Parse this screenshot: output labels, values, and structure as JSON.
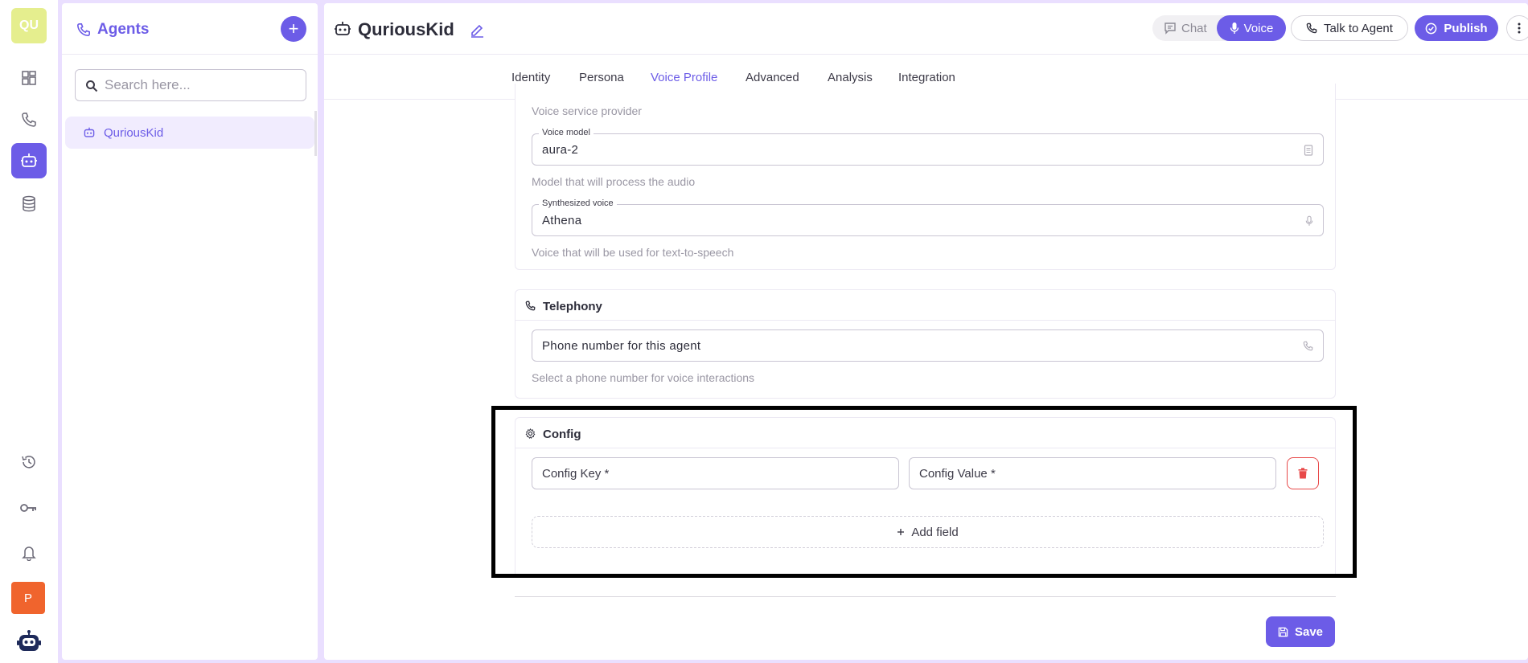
{
  "workspace": {
    "initials": "QU",
    "user_initial": "P"
  },
  "agents_panel": {
    "title": "Agents",
    "add_label": "+",
    "search_placeholder": "Search here...",
    "items": [
      {
        "label": "QuriousKid"
      }
    ]
  },
  "header": {
    "agent_name": "QuriousKid",
    "chat_label": "Chat",
    "voice_label": "Voice",
    "talk_label": "Talk to Agent",
    "publish_label": "Publish"
  },
  "tabs": [
    {
      "label": "Identity"
    },
    {
      "label": "Persona"
    },
    {
      "label": "Voice Profile",
      "active": true
    },
    {
      "label": "Advanced"
    },
    {
      "label": "Analysis"
    },
    {
      "label": "Integration"
    }
  ],
  "voice": {
    "provider_helper": "Voice service provider",
    "model_label": "Voice model",
    "model_value": "aura-2",
    "model_helper": "Model that will process the audio",
    "voice_label": "Synthesized voice",
    "voice_value": "Athena",
    "voice_helper": "Voice that will be used for text-to-speech"
  },
  "telephony": {
    "title": "Telephony",
    "phone_value": "Phone number for this agent",
    "phone_helper": "Select a phone number for voice interactions"
  },
  "config": {
    "title": "Config",
    "key_placeholder": "Config Key *",
    "value_placeholder": "Config Value *",
    "add_field_label": "Add field"
  },
  "footer": {
    "save_label": "Save"
  },
  "colors": {
    "accent": "#6c5ce7",
    "danger": "#e84a4a",
    "frame": "#eadfff",
    "workspace": "#e5ee8e",
    "avatar": "#f0642d"
  }
}
